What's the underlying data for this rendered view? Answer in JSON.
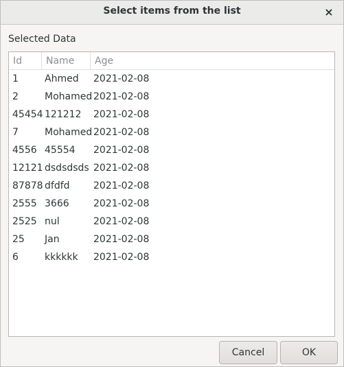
{
  "dialog": {
    "title": "Select items from the list",
    "close_glyph": "×",
    "close_icon": "close-icon"
  },
  "section_label": "Selected Data",
  "table": {
    "columns": [
      "Id",
      "Name",
      "Age"
    ],
    "rows": [
      {
        "id": "1",
        "name": "Ahmed",
        "age": "2021-02-08"
      },
      {
        "id": "2",
        "name": "Mohamed",
        "age": "2021-02-08"
      },
      {
        "id": "45454",
        "name": "121212",
        "age": "2021-02-08"
      },
      {
        "id": "7",
        "name": "Mohamed",
        "age": "2021-02-08"
      },
      {
        "id": "4556",
        "name": "45554",
        "age": "2021-02-08"
      },
      {
        "id": "12121",
        "name": "dsdsdsds",
        "age": "2021-02-08"
      },
      {
        "id": "87878",
        "name": "dfdfd",
        "age": "2021-02-08"
      },
      {
        "id": "2555",
        "name": "3666",
        "age": "2021-02-08"
      },
      {
        "id": "2525",
        "name": "nul",
        "age": "2021-02-08"
      },
      {
        "id": "25",
        "name": "Jan",
        "age": "2021-02-08"
      },
      {
        "id": "6",
        "name": "kkkkkk",
        "age": "2021-02-08"
      }
    ]
  },
  "buttons": {
    "cancel": "Cancel",
    "ok": "OK"
  }
}
